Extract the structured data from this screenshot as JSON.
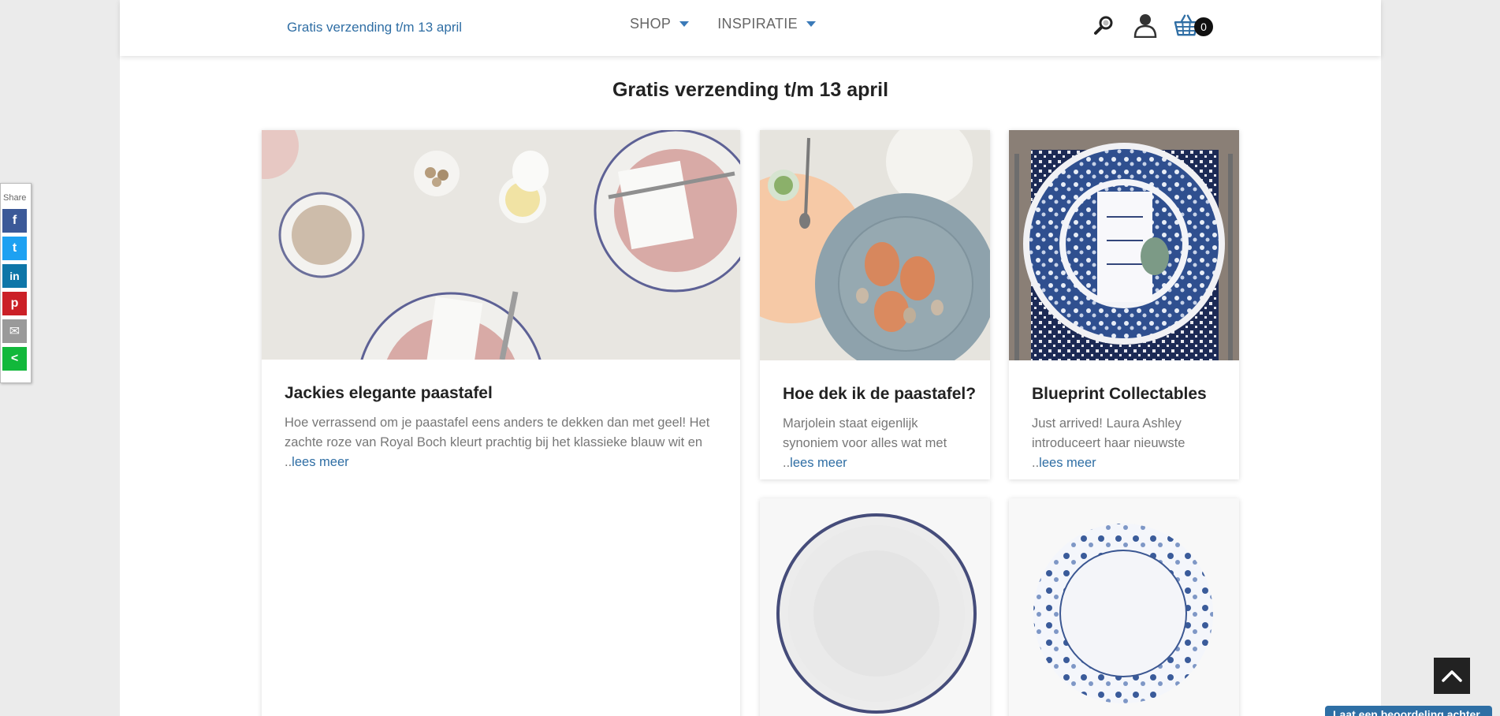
{
  "header": {
    "promo": "Gratis verzending t/m 13 april",
    "nav": [
      {
        "label": "SHOP"
      },
      {
        "label": "INSPIRATIE"
      }
    ],
    "cart_count": "0",
    "icons": [
      "search-icon",
      "user-icon",
      "basket-icon"
    ]
  },
  "page": {
    "title": "Gratis verzending t/m 13 april"
  },
  "cards": [
    {
      "title": "Jackies elegante paastafel",
      "excerpt": "Hoe verrassend om je paastafel eens anders te dekken dan met geel! Het zachte roze van Royal Boch kleurt prachtig bij het klassieke blauw wit en ..",
      "read_more": "lees meer"
    },
    {
      "title": "Hoe dek ik de paastafel?",
      "excerpt": "Marjolein staat eigenlijk synoniem voor alles wat met ..",
      "read_more": "lees meer"
    },
    {
      "title": "Blueprint Collectables",
      "excerpt": "Just arrived! Laura Ashley introduceert haar nieuwste ..",
      "read_more": "lees meer"
    }
  ],
  "share": {
    "label": "Share",
    "buttons": [
      {
        "glyph": "f",
        "color": "#3b5998"
      },
      {
        "glyph": "t",
        "color": "#1da1f2"
      },
      {
        "glyph": "in",
        "color": "#0e76a8"
      },
      {
        "glyph": "p",
        "color": "#cb2027"
      },
      {
        "glyph": "✉",
        "color": "#9a9a9a"
      },
      {
        "glyph": "<",
        "color": "#12b83b"
      }
    ]
  },
  "review_tab": "Laat een beoordeling achter",
  "colors": {
    "accent": "#2f6ea4",
    "caret": "#3a7ab8"
  }
}
